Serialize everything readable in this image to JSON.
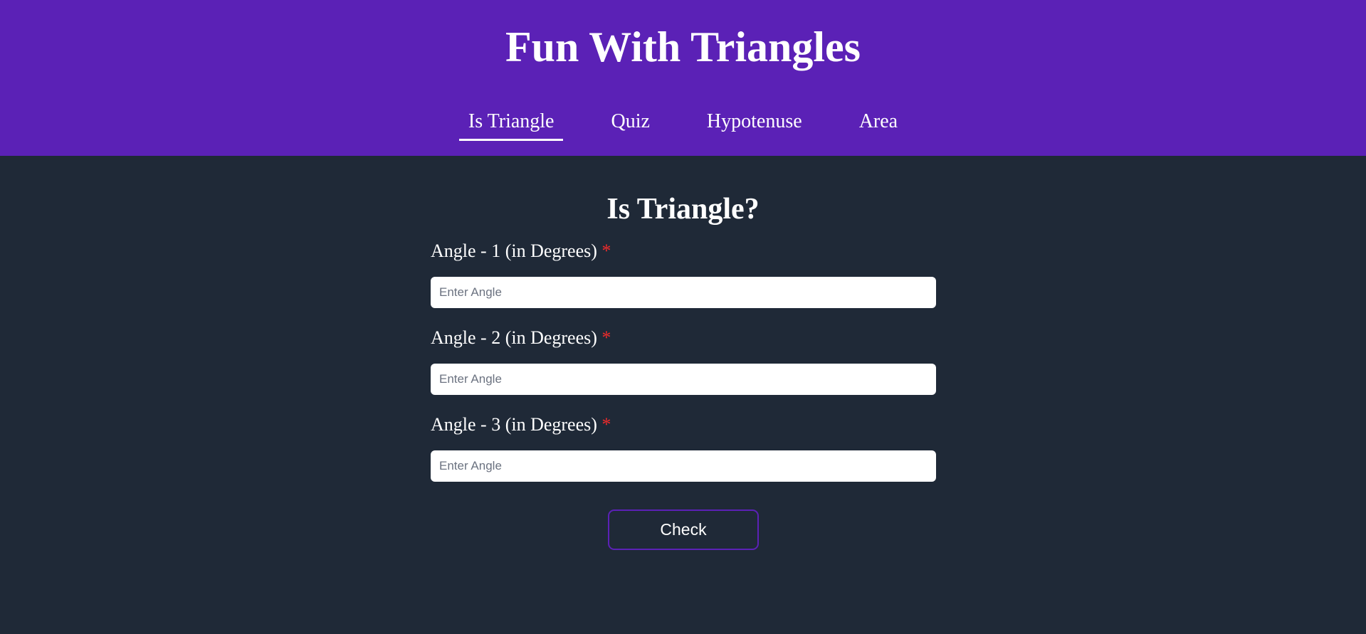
{
  "header": {
    "title": "Fun With Triangles",
    "nav": [
      {
        "label": "Is Triangle",
        "active": true
      },
      {
        "label": "Quiz",
        "active": false
      },
      {
        "label": "Hypotenuse",
        "active": false
      },
      {
        "label": "Area",
        "active": false
      }
    ]
  },
  "main": {
    "title": "Is Triangle?",
    "fields": [
      {
        "label": "Angle - 1 (in Degrees)",
        "required_mark": "*",
        "placeholder": "Enter Angle",
        "value": ""
      },
      {
        "label": "Angle - 2 (in Degrees)",
        "required_mark": "*",
        "placeholder": "Enter Angle",
        "value": ""
      },
      {
        "label": "Angle - 3 (in Degrees)",
        "required_mark": "*",
        "placeholder": "Enter Angle",
        "value": ""
      }
    ],
    "check_label": "Check"
  },
  "colors": {
    "header_bg": "#5b21b6",
    "page_bg": "#1f2937",
    "required": "#ef2b2b",
    "button_border": "#5b21b6"
  }
}
